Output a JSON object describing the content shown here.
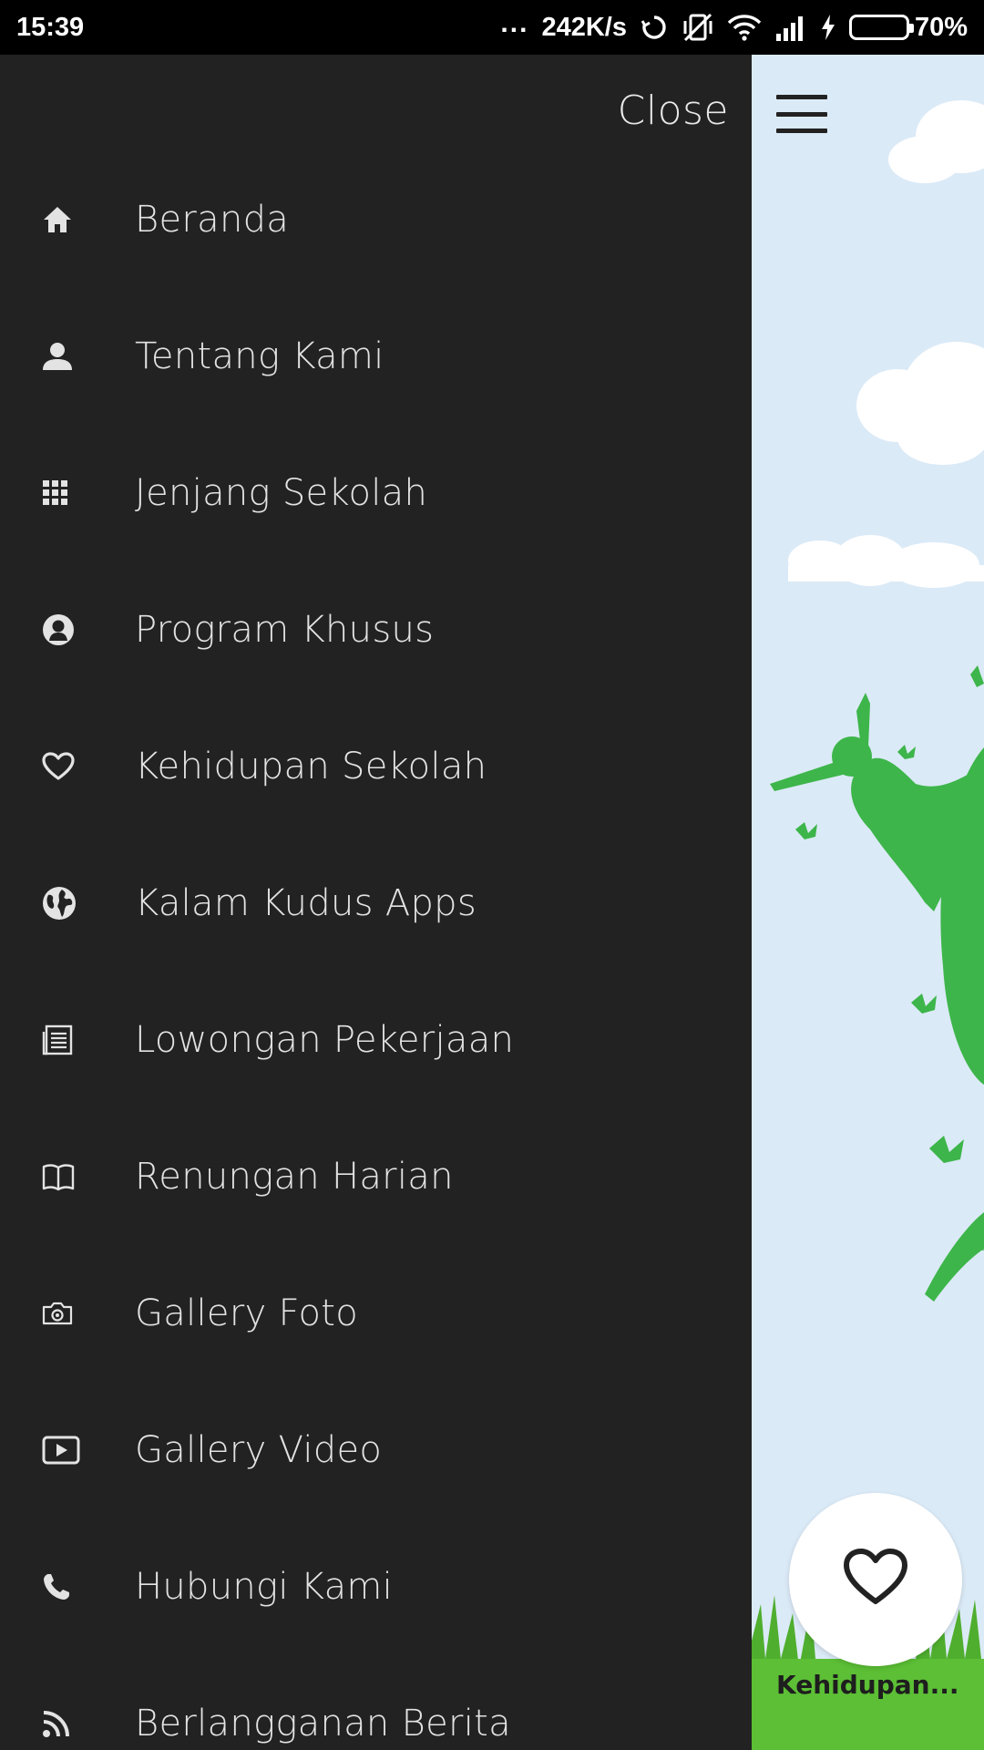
{
  "status_bar": {
    "time": "15:39",
    "dots": "...",
    "network_speed": "242K/s",
    "battery_percent": "70%",
    "battery_level": 0.7
  },
  "drawer": {
    "close_label": "Close",
    "items": [
      {
        "label": "Beranda",
        "icon": "home-icon"
      },
      {
        "label": "Tentang Kami",
        "icon": "person-icon"
      },
      {
        "label": "Jenjang Sekolah",
        "icon": "grid-icon"
      },
      {
        "label": "Program Khusus",
        "icon": "user-circle-icon"
      },
      {
        "label": "Kehidupan Sekolah",
        "icon": "heart-icon"
      },
      {
        "label": "Kalam Kudus Apps",
        "icon": "globe-icon"
      },
      {
        "label": "Lowongan Pekerjaan",
        "icon": "document-icon"
      },
      {
        "label": "Renungan Harian",
        "icon": "book-icon"
      },
      {
        "label": "Gallery Foto",
        "icon": "camera-icon"
      },
      {
        "label": "Gallery Video",
        "icon": "video-icon"
      },
      {
        "label": "Hubungi Kami",
        "icon": "phone-icon"
      },
      {
        "label": "Berlangganan Berita",
        "icon": "rss-icon"
      }
    ]
  },
  "background": {
    "fab_label": "Kehidupan...",
    "fab_icon": "heart-outline-icon",
    "accent_green": "#3db54a",
    "sky_color": "#dbeaf7"
  }
}
